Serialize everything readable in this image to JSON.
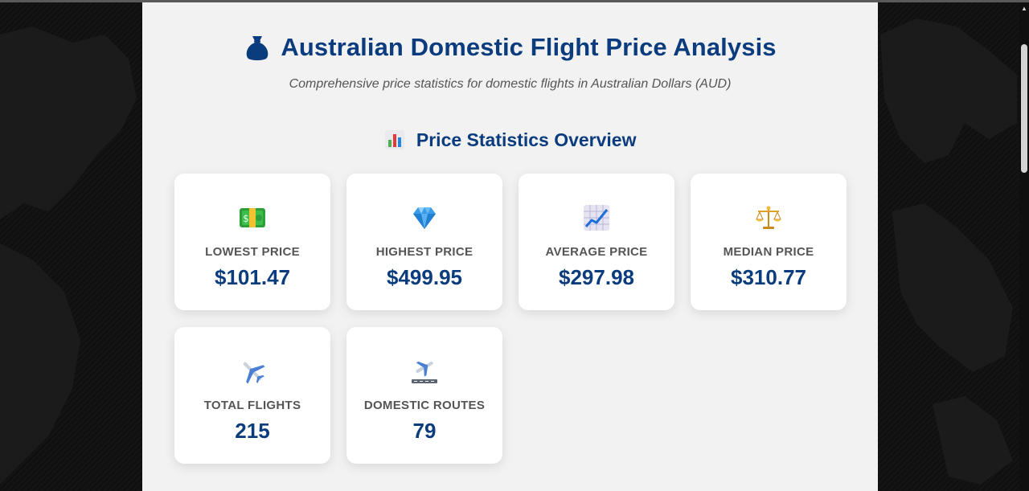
{
  "header": {
    "title": "Australian Domestic Flight Price Analysis",
    "subtitle": "Comprehensive price statistics for domestic flights in Australian Dollars (AUD)"
  },
  "section": {
    "title": "Price Statistics Overview",
    "icon": "bar-chart-icon"
  },
  "stats": [
    {
      "icon": "money-banknote-icon",
      "label": "LOWEST PRICE",
      "value": "$101.47"
    },
    {
      "icon": "diamond-icon",
      "label": "HIGHEST PRICE",
      "value": "$499.95"
    },
    {
      "icon": "trend-chart-icon",
      "label": "AVERAGE PRICE",
      "value": "$297.98"
    },
    {
      "icon": "scales-icon",
      "label": "MEDIAN PRICE",
      "value": "$310.77"
    },
    {
      "icon": "airplane-icon",
      "label": "TOTAL FLIGHTS",
      "value": "215"
    },
    {
      "icon": "airplane-departure-icon",
      "label": "DOMESTIC ROUTES",
      "value": "79"
    }
  ],
  "colors": {
    "accent": "#0b3c7d",
    "page_background": "#f2f2f3",
    "card_background": "#ffffff",
    "label_text": "#555555"
  }
}
